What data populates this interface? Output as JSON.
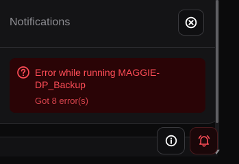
{
  "panel": {
    "title": "Notifications",
    "close_icon": "close-circle-icon"
  },
  "notifications": [
    {
      "icon": "question-circle-icon",
      "title": "Error while running MAGGIE-DP_Backup",
      "subtitle": "Got 8 error(s)",
      "color": "#ff4d57",
      "background": "#2a0406"
    }
  ],
  "toolbar": {
    "info_icon": "info-icon",
    "bell_icon": "bell-icon",
    "bell_color": "#ff4d57"
  }
}
